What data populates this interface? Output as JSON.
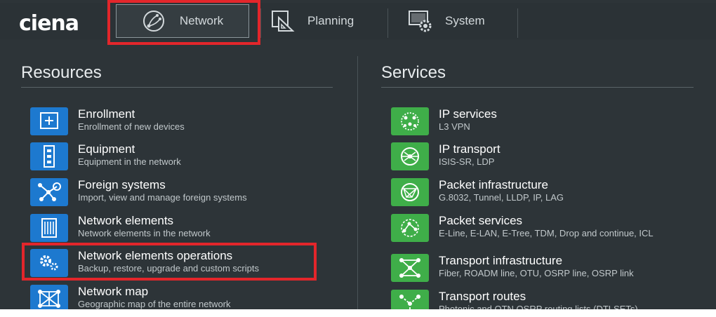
{
  "brand": {
    "logo_text": "ciena"
  },
  "nav": {
    "tabs": [
      {
        "label": "Network",
        "icon": "network-globe-icon",
        "selected": true
      },
      {
        "label": "Planning",
        "icon": "planning-ruler-icon",
        "selected": false
      },
      {
        "label": "System",
        "icon": "system-gear-icon",
        "selected": false
      }
    ]
  },
  "resources": {
    "title": "Resources",
    "items": [
      {
        "title": "Enrollment",
        "subtitle": "Enrollment of new devices",
        "icon": "plus-icon"
      },
      {
        "title": "Equipment",
        "subtitle": "Equipment in the network",
        "icon": "equipment-icon"
      },
      {
        "title": "Foreign systems",
        "subtitle": "Import, view and manage foreign systems",
        "icon": "foreign-systems-icon"
      },
      {
        "title": "Network elements",
        "subtitle": "Network elements in the network",
        "icon": "network-element-icon"
      },
      {
        "title": "Network elements operations",
        "subtitle": "Backup, restore, upgrade and custom scripts",
        "icon": "gears-icon"
      },
      {
        "title": "Network map",
        "subtitle": "Geographic map of the entire network",
        "icon": "network-map-icon"
      }
    ]
  },
  "services": {
    "title": "Services",
    "items": [
      {
        "title": "IP services",
        "subtitle": "L3 VPN",
        "icon": "ip-services-icon"
      },
      {
        "title": "IP transport",
        "subtitle": "ISIS-SR, LDP",
        "icon": "ip-transport-icon"
      },
      {
        "title": "Packet infrastructure",
        "subtitle": "G.8032, Tunnel, LLDP, IP, LAG",
        "icon": "packet-infrastructure-icon"
      },
      {
        "title": "Packet services",
        "subtitle": "E-Line, E-LAN, E-Tree, TDM, Drop and continue, ICL",
        "icon": "packet-services-icon"
      },
      {
        "title": "Transport infrastructure",
        "subtitle": "Fiber, ROADM line, OTU, OSRP line, OSRP link",
        "icon": "transport-infrastructure-icon"
      },
      {
        "title": "Transport routes",
        "subtitle": "Photonic and OTN OSRP routing lists (DTLSETs)",
        "icon": "transport-routes-icon"
      }
    ]
  },
  "colors": {
    "background": "#2d3438",
    "resource_tile": "#1d79cf",
    "service_tile": "#3fae49",
    "highlight": "#e3262b"
  }
}
